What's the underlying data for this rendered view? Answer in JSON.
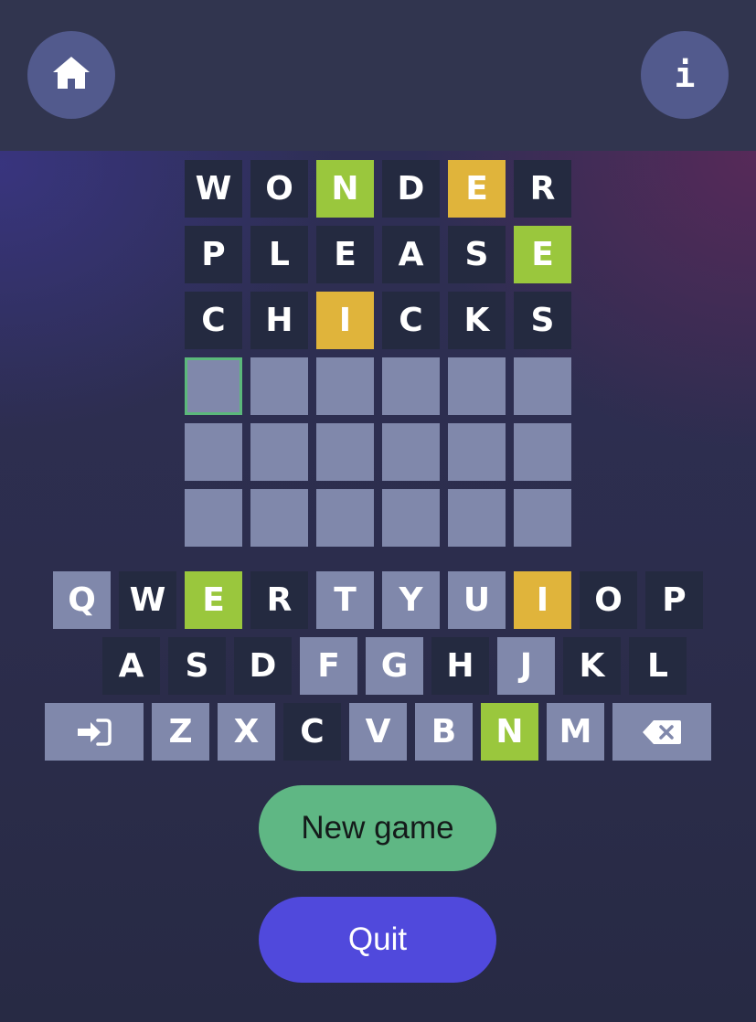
{
  "header": {
    "home_icon": "home-icon",
    "info_label": "i"
  },
  "board": {
    "rows": [
      [
        {
          "letter": "W",
          "state": "absent"
        },
        {
          "letter": "O",
          "state": "absent"
        },
        {
          "letter": "N",
          "state": "correct"
        },
        {
          "letter": "D",
          "state": "absent"
        },
        {
          "letter": "E",
          "state": "present"
        },
        {
          "letter": "R",
          "state": "absent"
        }
      ],
      [
        {
          "letter": "P",
          "state": "absent"
        },
        {
          "letter": "L",
          "state": "absent"
        },
        {
          "letter": "E",
          "state": "absent"
        },
        {
          "letter": "A",
          "state": "absent"
        },
        {
          "letter": "S",
          "state": "absent"
        },
        {
          "letter": "E",
          "state": "correct"
        }
      ],
      [
        {
          "letter": "C",
          "state": "absent"
        },
        {
          "letter": "H",
          "state": "absent"
        },
        {
          "letter": "I",
          "state": "present"
        },
        {
          "letter": "C",
          "state": "absent"
        },
        {
          "letter": "K",
          "state": "absent"
        },
        {
          "letter": "S",
          "state": "absent"
        }
      ],
      [
        {
          "letter": "",
          "state": "active"
        },
        {
          "letter": "",
          "state": "empty"
        },
        {
          "letter": "",
          "state": "empty"
        },
        {
          "letter": "",
          "state": "empty"
        },
        {
          "letter": "",
          "state": "empty"
        },
        {
          "letter": "",
          "state": "empty"
        }
      ],
      [
        {
          "letter": "",
          "state": "empty"
        },
        {
          "letter": "",
          "state": "empty"
        },
        {
          "letter": "",
          "state": "empty"
        },
        {
          "letter": "",
          "state": "empty"
        },
        {
          "letter": "",
          "state": "empty"
        },
        {
          "letter": "",
          "state": "empty"
        }
      ],
      [
        {
          "letter": "",
          "state": "empty"
        },
        {
          "letter": "",
          "state": "empty"
        },
        {
          "letter": "",
          "state": "empty"
        },
        {
          "letter": "",
          "state": "empty"
        },
        {
          "letter": "",
          "state": "empty"
        },
        {
          "letter": "",
          "state": "empty"
        }
      ]
    ]
  },
  "keyboard": {
    "rows": [
      [
        {
          "label": "Q",
          "state": "unused"
        },
        {
          "label": "W",
          "state": "absent"
        },
        {
          "label": "E",
          "state": "correct"
        },
        {
          "label": "R",
          "state": "absent"
        },
        {
          "label": "T",
          "state": "unused"
        },
        {
          "label": "Y",
          "state": "unused"
        },
        {
          "label": "U",
          "state": "unused"
        },
        {
          "label": "I",
          "state": "present"
        },
        {
          "label": "O",
          "state": "absent"
        },
        {
          "label": "P",
          "state": "absent"
        }
      ],
      [
        {
          "label": "A",
          "state": "absent"
        },
        {
          "label": "S",
          "state": "absent"
        },
        {
          "label": "D",
          "state": "absent"
        },
        {
          "label": "F",
          "state": "unused"
        },
        {
          "label": "G",
          "state": "unused"
        },
        {
          "label": "H",
          "state": "absent"
        },
        {
          "label": "J",
          "state": "unused"
        },
        {
          "label": "K",
          "state": "absent"
        },
        {
          "label": "L",
          "state": "absent"
        }
      ],
      [
        {
          "label": "",
          "icon": "enter-icon",
          "state": "unused"
        },
        {
          "label": "Z",
          "state": "unused"
        },
        {
          "label": "X",
          "state": "unused"
        },
        {
          "label": "C",
          "state": "absent"
        },
        {
          "label": "V",
          "state": "unused"
        },
        {
          "label": "B",
          "state": "unused"
        },
        {
          "label": "N",
          "state": "correct"
        },
        {
          "label": "M",
          "state": "unused"
        },
        {
          "label": "",
          "icon": "backspace-icon",
          "state": "unused"
        }
      ]
    ]
  },
  "buttons": {
    "new_game": "New game",
    "quit": "Quit"
  },
  "colors": {
    "correct": "#9ac73d",
    "present": "#e0b43b",
    "absent": "#242a40",
    "unused": "#8088ab",
    "new_game_bg": "#5fb784",
    "quit_bg": "#5049dc"
  }
}
